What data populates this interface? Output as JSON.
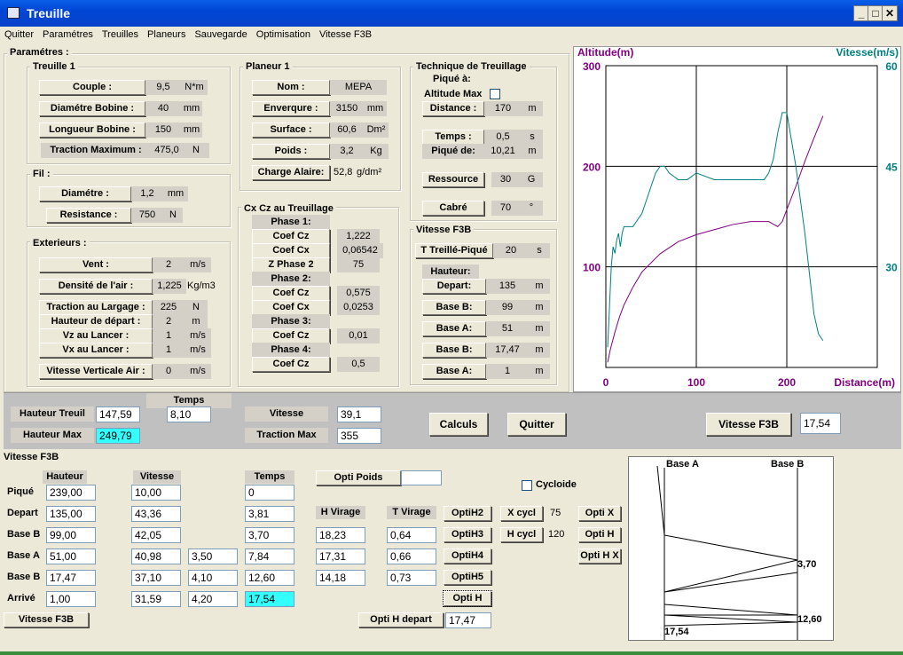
{
  "window": {
    "title": "Treuille"
  },
  "menu": [
    "Quitter",
    "Paramétres",
    "Treuilles",
    "Planeurs",
    "Sauvegarde",
    "Optimisation",
    "Vitesse F3B"
  ],
  "params": {
    "title": "Paramétres :",
    "treuille": {
      "title": "Treuille 1",
      "couple": {
        "label": "Couple :",
        "value": "9,5",
        "unit": "N*m"
      },
      "diametre": {
        "label": "Diamétre Bobine :",
        "value": "40",
        "unit": "mm"
      },
      "longueur": {
        "label": "Longueur Bobine :",
        "value": "150",
        "unit": "mm"
      },
      "traction": {
        "label": "Traction Maximum :",
        "value": "475,0",
        "unit": "N"
      }
    },
    "fil": {
      "title": "Fil :",
      "diametre": {
        "label": "Diamétre :",
        "value": "1,2",
        "unit": "mm"
      },
      "resistance": {
        "label": "Resistance :",
        "value": "750",
        "unit": "N"
      }
    },
    "exterieurs": {
      "title": "Exterieurs :",
      "vent": {
        "label": "Vent :",
        "value": "2",
        "unit": "m/s"
      },
      "densite": {
        "label": "Densité de l'air :",
        "value": "1,225",
        "unit": "Kg/m3"
      },
      "largage": {
        "label": "Traction au Largage :",
        "value": "225",
        "unit": "N"
      },
      "hauteur": {
        "label": "Hauteur de départ :",
        "value": "2",
        "unit": "m"
      },
      "vz": {
        "label": "Vz au Lancer :",
        "value": "1",
        "unit": "m/s"
      },
      "vx": {
        "label": "Vx au Lancer :",
        "value": "1",
        "unit": "m/s"
      },
      "vvair": {
        "label": "Vitesse Verticale Air :",
        "value": "0",
        "unit": "m/s"
      }
    },
    "planeur": {
      "title": "Planeur 1",
      "nom": {
        "label": "Nom :",
        "value": "MEPA"
      },
      "envergure": {
        "label": "Enverqure :",
        "value": "3150",
        "unit": "mm"
      },
      "surface": {
        "label": "Surface :",
        "value": "60,6",
        "unit": "Dm²"
      },
      "poids": {
        "label": "Poids :",
        "value": "3,2",
        "unit": "Kg"
      },
      "charge": {
        "label": "Charge Alaire:",
        "value": "52,8",
        "unit": "g/dm²"
      }
    },
    "cxcz": {
      "title": "Cx Cz au Treuillage",
      "phase1": "Phase 1:",
      "p1cz": {
        "label": "Coef Cz",
        "value": "1,222"
      },
      "p1cx": {
        "label": "Coef Cx",
        "value": "0,06542"
      },
      "p1z": {
        "label": "Z Phase 2",
        "value": "75"
      },
      "phase2": "Phase 2:",
      "p2cz": {
        "label": "Coef Cz",
        "value": "0,575"
      },
      "p2cx": {
        "label": "Coef Cx",
        "value": "0,0253"
      },
      "phase3": "Phase 3:",
      "p3cz": {
        "label": "Coef Cz",
        "value": "0,01"
      },
      "phase4": "Phase 4:",
      "p4cz": {
        "label": "Coef Cz",
        "value": "0,5"
      }
    },
    "technique": {
      "title": "Technique de Treuillage",
      "pique": "Piqué à:",
      "altmax": "Altitude Max",
      "distance": {
        "label": "Distance :",
        "value": "170",
        "unit": "m"
      },
      "temps": {
        "label": "Temps :",
        "value": "0,5",
        "unit": "s"
      },
      "piquede": {
        "label": "Piqué de:",
        "value": "10,21",
        "unit": "m"
      },
      "ressource": {
        "label": "Ressource",
        "value": "30",
        "unit": "G"
      },
      "cabre": {
        "label": "Cabré",
        "value": "70",
        "unit": "°"
      }
    },
    "vf3b": {
      "title": "Vitesse F3B",
      "treille": {
        "label": "T Treillé-Piqué",
        "value": "20",
        "unit": "s"
      },
      "hauteur": "Hauteur:",
      "depart": {
        "label": "Depart:",
        "value": "135",
        "unit": "m"
      },
      "baseb1": {
        "label": "Base B:",
        "value": "99",
        "unit": "m"
      },
      "basea1": {
        "label": "Base A:",
        "value": "51",
        "unit": "m"
      },
      "baseb2": {
        "label": "Base B:",
        "value": "17,47",
        "unit": "m"
      },
      "basea2": {
        "label": "Base A:",
        "value": "1",
        "unit": "m"
      }
    }
  },
  "chart_data": {
    "type": "line",
    "xlabel": "Distance(m)",
    "ylabel": "Altitude(m)",
    "y2label": "Vitesse(m/s)",
    "xlim": [
      0,
      300
    ],
    "ylim": [
      0,
      300
    ],
    "y2lim": [
      15,
      60
    ],
    "xticks": [
      "0",
      "100",
      "200"
    ],
    "yticks": [
      "100",
      "200",
      "300"
    ],
    "y2ticks": [
      "30",
      "45",
      "60"
    ],
    "grid": true,
    "series": [
      {
        "color": "#800080",
        "x": [
          2,
          5,
          10,
          15,
          20,
          30,
          40,
          60,
          80,
          100,
          120,
          140,
          160,
          180,
          190,
          195,
          200,
          210,
          220,
          230,
          240
        ],
        "y": [
          5,
          18,
          35,
          50,
          62,
          80,
          95,
          113,
          125,
          132,
          137,
          142,
          145,
          145,
          140,
          145,
          157,
          180,
          205,
          228,
          250
        ]
      },
      {
        "color": "#008080",
        "x": [
          2,
          4,
          6,
          8,
          10,
          12,
          14,
          16,
          18,
          20,
          25,
          30,
          35,
          40,
          45,
          50,
          55,
          60,
          65,
          70,
          80,
          90,
          100,
          120,
          140,
          160,
          175,
          180,
          185,
          190,
          195,
          200,
          205,
          210,
          215,
          220,
          225,
          230,
          235,
          240
        ],
        "y2": [
          18,
          24,
          30,
          33,
          32,
          34,
          35,
          33,
          35,
          36,
          36,
          36,
          37,
          38,
          40,
          42,
          44,
          45,
          45,
          44,
          43,
          43,
          44,
          43,
          43,
          43,
          43,
          44,
          46,
          50,
          53,
          53,
          49,
          45,
          40,
          35,
          29,
          23,
          20,
          19
        ]
      }
    ]
  },
  "mid": {
    "temps_label": "Temps",
    "hauteur_treuil": {
      "label": "Hauteur Treuil",
      "value": "147,59"
    },
    "temps_value": "8,10",
    "hauteur_max": {
      "label": "Hauteur Max",
      "value": "249,79"
    },
    "vitesse": {
      "label": "Vitesse",
      "value": "39,1"
    },
    "traction": {
      "label": "Traction  Max",
      "value": "355"
    },
    "calculs": "Calculs",
    "quitter": "Quitter",
    "vitesse_f3b": {
      "label": "Vitesse F3B",
      "value": "17,54"
    }
  },
  "bottom": {
    "title": "Vitesse F3B",
    "headers": {
      "hauteur": "Hauteur",
      "vitesse": "Vitesse",
      "temps": "Temps",
      "hvirage": "H Virage",
      "tvirage": "T Virage"
    },
    "rows": [
      {
        "label": "Piqué",
        "h": "239,00",
        "v": "10,00",
        "x": "",
        "t": "0",
        "hv": "",
        "tv": ""
      },
      {
        "label": "Depart",
        "h": "135,00",
        "v": "43,36",
        "x": "",
        "t": "3,81",
        "hv": "18,23",
        "tv": "0,64"
      },
      {
        "label": "Base B",
        "h": "99,00",
        "v": "42,05",
        "x": "",
        "t": "3,70",
        "hv": "17,31",
        "tv": "0,66"
      },
      {
        "label": "Base A",
        "h": "51,00",
        "v": "40,98",
        "x": "3,50",
        "t": "7,84",
        "hv": "14,18",
        "tv": "0,73"
      },
      {
        "label": "Base B",
        "h": "17,47",
        "v": "37,10",
        "x": "4,10",
        "t": "12,60",
        "hv": "",
        "tv": ""
      },
      {
        "label": "Arrivé",
        "h": "1,00",
        "v": "31,59",
        "x": "4,20",
        "t": "17,54",
        "hv": "",
        "tv": ""
      }
    ],
    "opti_poids": "Opti Poids",
    "optih2": "OptiH2",
    "optih3": "OptiH3",
    "optih4": "OptiH4",
    "optih5": "OptiH5",
    "optih": "Opti H",
    "cycloide": "Cycloide",
    "xcycl": {
      "label": "X cycl",
      "value": "75"
    },
    "hcycl": {
      "label": "H cycl",
      "value": "120"
    },
    "optix": "Opti X",
    "optih_b": "Opti H",
    "optihx": "Opti H X",
    "optih_depart": {
      "label": "Opti H depart",
      "value": "17,47"
    },
    "vitesse_f3b_btn": "Vitesse F3B"
  },
  "course": {
    "base_a": "Base A",
    "base_b": "Base B",
    "t1": "3,70",
    "t2": "12,60",
    "t3": "17,54"
  }
}
